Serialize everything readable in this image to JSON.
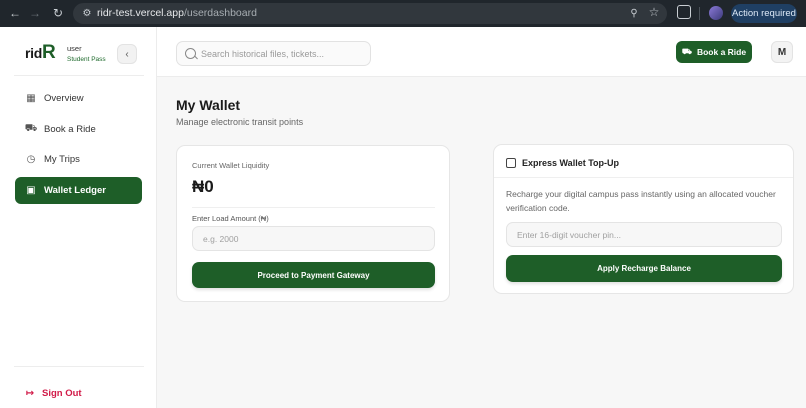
{
  "browser": {
    "url_host": "ridr-test.vercel.app",
    "url_path": "/userdashboard",
    "action_pill": "Action required",
    "icons": {
      "back": "arrow-left-icon",
      "forward": "arrow-right-icon",
      "reload": "reload-icon",
      "site_info": "tune-icon",
      "password": "key-icon",
      "bookmark": "star-icon",
      "extensions": "puzzle-icon"
    }
  },
  "sidebar": {
    "brand_prefix": "rid",
    "brand_suffix": "R",
    "user_name": "user",
    "user_role": "Student Pass",
    "items": [
      {
        "label": "Overview",
        "icon": "grid-icon",
        "active": false
      },
      {
        "label": "Book a Ride",
        "icon": "car-icon",
        "active": false
      },
      {
        "label": "My Trips",
        "icon": "clock-icon",
        "active": false
      },
      {
        "label": "Wallet Ledger",
        "icon": "wallet-icon",
        "active": true
      }
    ],
    "sign_out": "Sign Out"
  },
  "topbar": {
    "search_placeholder": "Search historical files, tickets...",
    "book_button": "Book a Ride",
    "avatar_initial": "M"
  },
  "main": {
    "title": "My Wallet",
    "subtitle": "Manage electronic transit points",
    "wallet": {
      "liquidity_label": "Current Wallet Liquidity",
      "balance": "₦0",
      "amount_label": "Enter Load Amount (₦)",
      "amount_placeholder": "e.g. 2000",
      "button": "Proceed to Payment Gateway"
    },
    "topup": {
      "title": "Express Wallet Top-Up",
      "description": "Recharge your digital campus pass instantly using an allocated voucher verification code.",
      "pin_placeholder": "Enter 16-digit voucher pin...",
      "button": "Apply Recharge Balance"
    }
  },
  "colors": {
    "brand_green": "#1e5e28",
    "danger": "#d11a48",
    "chrome_bg": "#20262c",
    "action_pill_bg": "#1f3f63"
  }
}
